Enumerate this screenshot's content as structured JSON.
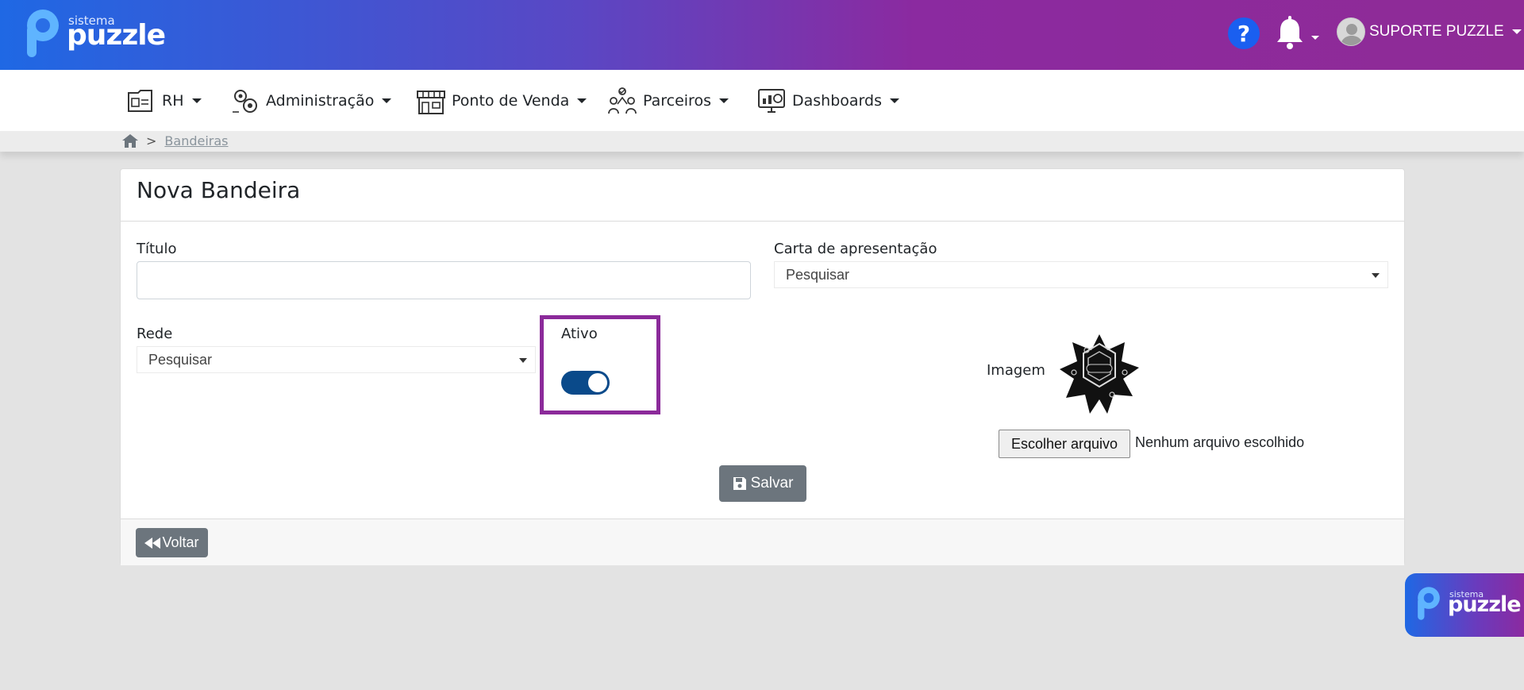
{
  "header": {
    "logo_small": "sistema",
    "logo_big": "puzzle",
    "help_glyph": "?",
    "user_name": "SUPORTE PUZZLE"
  },
  "nav": {
    "items": [
      {
        "label": "RH",
        "icon": "hr-folder-icon"
      },
      {
        "label": "Administração",
        "icon": "admin-gears-icon"
      },
      {
        "label": "Ponto de Venda",
        "icon": "store-icon"
      },
      {
        "label": "Parceiros",
        "icon": "partners-icon"
      },
      {
        "label": "Dashboards",
        "icon": "dashboard-monitor-icon"
      }
    ]
  },
  "breadcrumb": {
    "separator": ">",
    "current": "Bandeiras"
  },
  "form": {
    "title": "Nova Bandeira",
    "titulo_label": "Título",
    "titulo_value": "",
    "carta_label": "Carta de apresentação",
    "carta_value": "Pesquisar",
    "rede_label": "Rede",
    "rede_value": "Pesquisar",
    "ativo_label": "Ativo",
    "ativo_on": true,
    "imagem_label": "Imagem",
    "file_button": "Escolher arquivo",
    "file_status": "Nenhum arquivo escolhido",
    "save_label": "Salvar",
    "back_label": "Voltar"
  },
  "colors": {
    "header_gradient_start": "#1f68e4",
    "header_gradient_end": "#8f2b96",
    "highlight_border": "#8b2a9a",
    "toggle_on": "#0a4a8a",
    "button_gray": "#6c757d"
  },
  "float_logo": {
    "small": "sistema",
    "big": "puzzle"
  }
}
